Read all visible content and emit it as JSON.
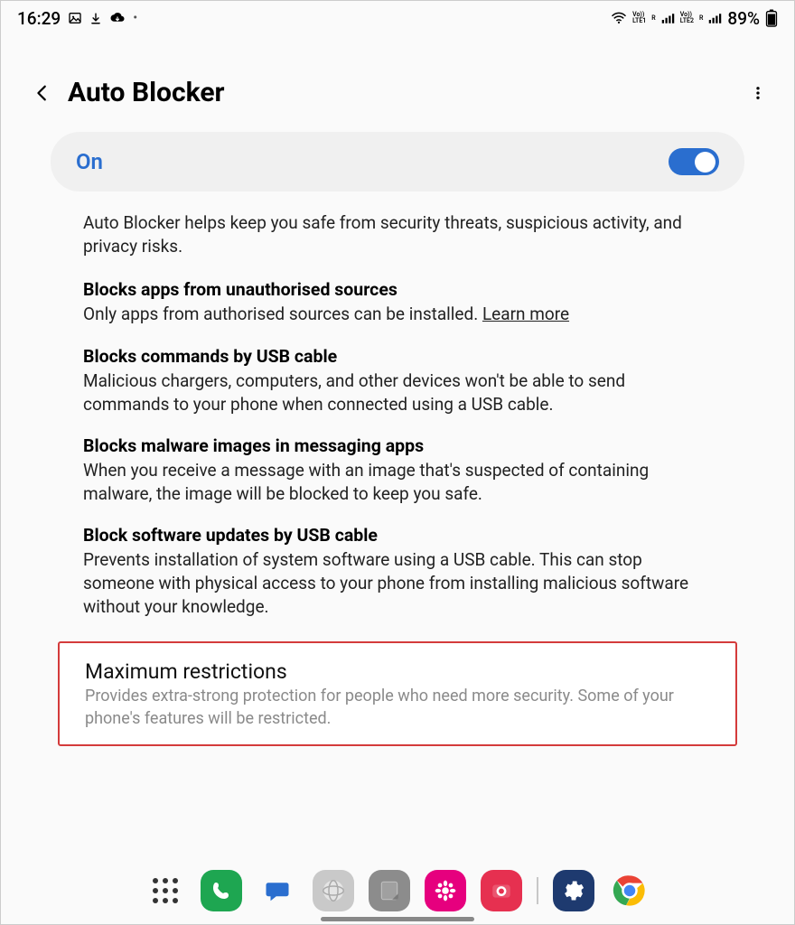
{
  "status_bar": {
    "time": "16:29",
    "battery_text": "89%",
    "lte1": "LTE1",
    "lte2": "LTE2",
    "volte": "Vo))",
    "r": "R"
  },
  "header": {
    "title": "Auto Blocker"
  },
  "toggle": {
    "state_label": "On"
  },
  "intro": "Auto Blocker helps keep you safe from security threats, suspicious activity, and privacy risks.",
  "sections": [
    {
      "title": "Blocks apps from unauthorised sources",
      "desc": "Only apps from authorised sources can be installed. ",
      "learn_more": "Learn more"
    },
    {
      "title": "Blocks commands by USB cable",
      "desc": "Malicious chargers, computers, and other devices won't be able to send commands to your phone when connected using a USB cable."
    },
    {
      "title": "Blocks malware images in messaging apps",
      "desc": "When you receive a message with an image that's suspected of containing malware, the image will be blocked to keep you safe."
    },
    {
      "title": "Block software updates by USB cable",
      "desc": "Prevents installation of system software using a USB cable. This can stop someone with physical access to your phone from installing malicious software without your knowledge."
    }
  ],
  "max_restrictions": {
    "title": "Maximum restrictions",
    "desc": "Provides extra-strong protection for people who need more security. Some of your phone's features will be restricted."
  }
}
